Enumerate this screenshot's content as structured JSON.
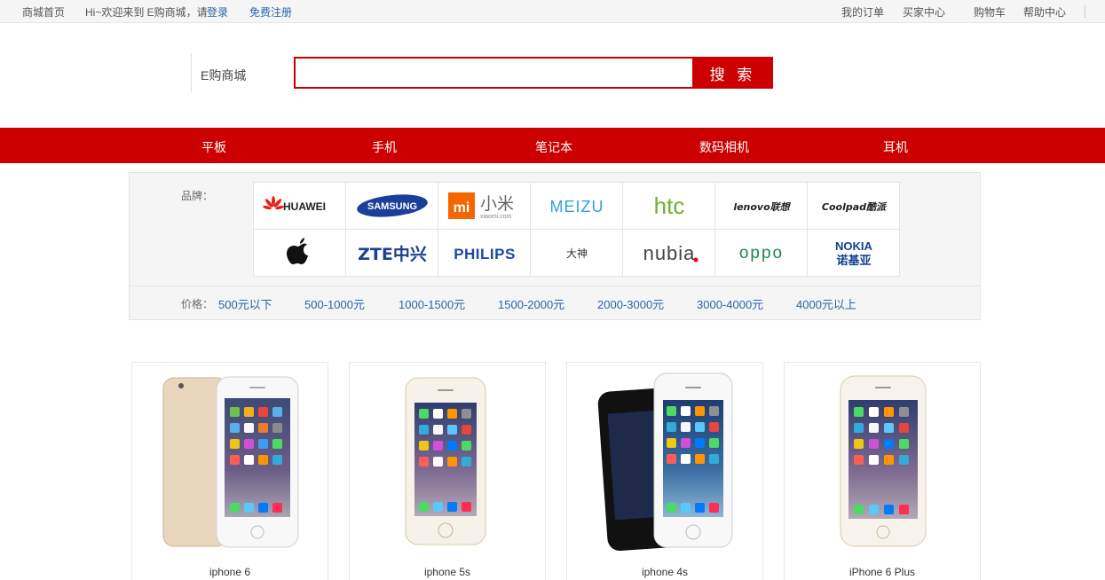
{
  "topbar": {
    "home": "商城首页",
    "welcome": "Hi~欢迎来到 E购商城，请",
    "login": "登录",
    "register": "免费注册",
    "my_orders": "我的订单",
    "buyer_center": "买家中心",
    "cart": "购物车",
    "help": "帮助中心"
  },
  "header": {
    "logo": "E购商城",
    "search_placeholder": "",
    "search_button": "搜 索"
  },
  "nav": {
    "items": [
      "平板",
      "手机",
      "笔记本",
      "数码相机",
      "耳机"
    ]
  },
  "filter": {
    "brand_label": "品牌：",
    "brands": [
      {
        "name": "HUAWEI",
        "icon": "huawei-logo"
      },
      {
        "name": "SAMSUNG",
        "icon": "samsung-logo"
      },
      {
        "name": "小米",
        "sub": "xiaomi.com",
        "mark": "mi",
        "icon": "xiaomi-logo"
      },
      {
        "name": "MEIZU",
        "icon": "meizu-logo"
      },
      {
        "name": "htc",
        "icon": "htc-logo"
      },
      {
        "name": "lenovo联想",
        "icon": "lenovo-logo"
      },
      {
        "name": "Coolpad酷派",
        "icon": "coolpad-logo"
      },
      {
        "name": "Apple",
        "icon": "apple-logo"
      },
      {
        "name": "ZTE中兴",
        "icon": "zte-logo"
      },
      {
        "name": "PHILIPS",
        "icon": "philips-logo"
      },
      {
        "name": "大神",
        "icon": "dashen-logo"
      },
      {
        "name": "nubia",
        "icon": "nubia-logo"
      },
      {
        "name": "oppo",
        "icon": "oppo-logo"
      },
      {
        "name": "NOKIA",
        "sub": "诺基亚",
        "icon": "nokia-logo"
      }
    ],
    "price_label": "价格：",
    "prices": [
      "500元以下",
      "500-1000元",
      "1000-1500元",
      "1500-2000元",
      "2000-3000元",
      "3000-4000元",
      "4000元以上"
    ]
  },
  "products": [
    {
      "name": "iphone 6",
      "image": "iphone-6-gold-image"
    },
    {
      "name": "iphone 5s",
      "image": "iphone-5s-image"
    },
    {
      "name": "iphone 4s",
      "image": "iphone-4s-image"
    },
    {
      "name": "iPhone 6 Plus",
      "image": "iphone-6-plus-image"
    }
  ],
  "colors": {
    "brand_red": "#cc0000",
    "link_blue": "#2a64a8"
  }
}
